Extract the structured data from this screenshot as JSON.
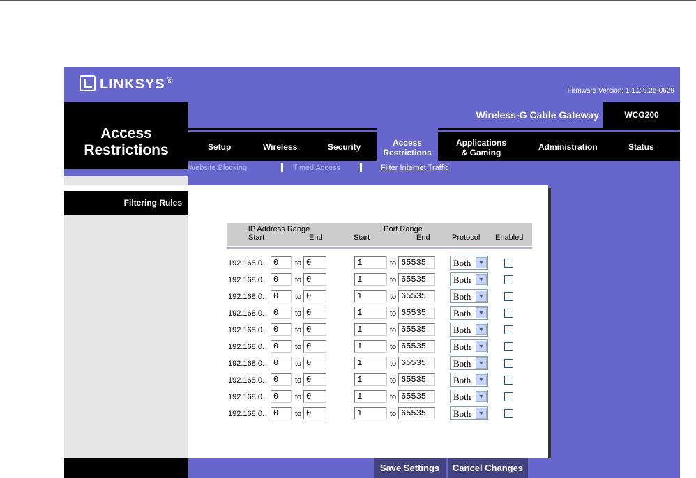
{
  "brand": {
    "name": "LINKSYS",
    "registered": "®"
  },
  "firmware": "Firmware Version: 1.1.2.9.2d-0629",
  "page_title": {
    "line1": "Access",
    "line2": "Restrictions"
  },
  "product": {
    "name": "Wireless-G Cable Gateway",
    "model": "WCG200"
  },
  "nav": {
    "setup": "Setup",
    "wireless": "Wireless",
    "security": "Security",
    "access_1": "Access",
    "access_2": "Restrictions",
    "apps_1": "Applications",
    "apps_2": "& Gaming",
    "administration": "Administration",
    "status": "Status"
  },
  "subnav": {
    "website_blocking": "Website Blocking",
    "timed_access": "Timed Access",
    "filter_traffic": "Filter Internet Traffic"
  },
  "section_label": "Filtering Rules",
  "table": {
    "ip_range": "IP Address Range",
    "ip_start": "Start",
    "ip_end": "End",
    "port_range": "Port Range",
    "port_start": "Start",
    "port_end": "End",
    "protocol": "Protocol",
    "enabled": "Enabled",
    "rows": [
      {
        "prefix": "192.168.0.",
        "ip_start": "0",
        "to1": "to",
        "ip_end": "0",
        "port_start": "1",
        "to2": "to",
        "port_end": "65535",
        "protocol": "Both",
        "enabled": false
      },
      {
        "prefix": "192.168.0.",
        "ip_start": "0",
        "to1": "to",
        "ip_end": "0",
        "port_start": "1",
        "to2": "to",
        "port_end": "65535",
        "protocol": "Both",
        "enabled": false
      },
      {
        "prefix": "192.168.0.",
        "ip_start": "0",
        "to1": "to",
        "ip_end": "0",
        "port_start": "1",
        "to2": "to",
        "port_end": "65535",
        "protocol": "Both",
        "enabled": false
      },
      {
        "prefix": "192.168.0.",
        "ip_start": "0",
        "to1": "to",
        "ip_end": "0",
        "port_start": "1",
        "to2": "to",
        "port_end": "65535",
        "protocol": "Both",
        "enabled": false
      },
      {
        "prefix": "192.168.0.",
        "ip_start": "0",
        "to1": "to",
        "ip_end": "0",
        "port_start": "1",
        "to2": "to",
        "port_end": "65535",
        "protocol": "Both",
        "enabled": false
      },
      {
        "prefix": "192.168.0.",
        "ip_start": "0",
        "to1": "to",
        "ip_end": "0",
        "port_start": "1",
        "to2": "to",
        "port_end": "65535",
        "protocol": "Both",
        "enabled": false
      },
      {
        "prefix": "192.168.0.",
        "ip_start": "0",
        "to1": "to",
        "ip_end": "0",
        "port_start": "1",
        "to2": "to",
        "port_end": "65535",
        "protocol": "Both",
        "enabled": false
      },
      {
        "prefix": "192.168.0.",
        "ip_start": "0",
        "to1": "to",
        "ip_end": "0",
        "port_start": "1",
        "to2": "to",
        "port_end": "65535",
        "protocol": "Both",
        "enabled": false
      },
      {
        "prefix": "192.168.0.",
        "ip_start": "0",
        "to1": "to",
        "ip_end": "0",
        "port_start": "1",
        "to2": "to",
        "port_end": "65535",
        "protocol": "Both",
        "enabled": false
      },
      {
        "prefix": "192.168.0.",
        "ip_start": "0",
        "to1": "to",
        "ip_end": "0",
        "port_start": "1",
        "to2": "to",
        "port_end": "65535",
        "protocol": "Both",
        "enabled": false
      }
    ]
  },
  "buttons": {
    "save": "Save Settings",
    "cancel": "Cancel Changes"
  },
  "colors": {
    "brand_purple": "#6666cc",
    "black": "#000000",
    "button_navy": "#434382"
  }
}
